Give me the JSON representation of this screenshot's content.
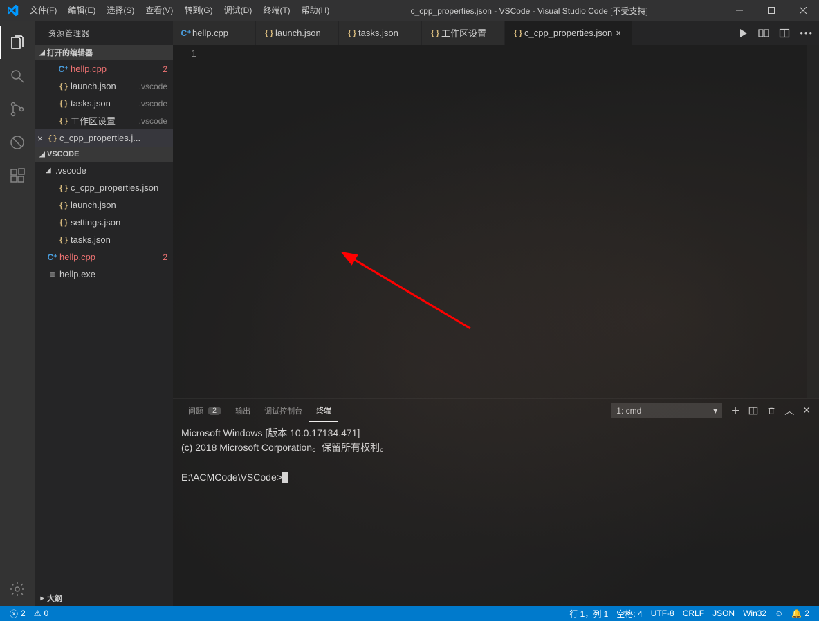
{
  "titlebar": {
    "menus": [
      "文件(F)",
      "编辑(E)",
      "选择(S)",
      "查看(V)",
      "转到(G)",
      "调试(D)",
      "终端(T)",
      "帮助(H)"
    ],
    "title": "c_cpp_properties.json - VSCode - Visual Studio Code [不受支持]"
  },
  "sidebar": {
    "title": "资源管理器",
    "openEditors": {
      "header": "打开的编辑器",
      "items": [
        {
          "icon": "cpp",
          "iconText": "C⁺",
          "name": "hellp.cpp",
          "error": true,
          "badge": "2"
        },
        {
          "icon": "json",
          "iconText": "{ }",
          "name": "launch.json",
          "path": ".vscode"
        },
        {
          "icon": "json",
          "iconText": "{ }",
          "name": "tasks.json",
          "path": ".vscode"
        },
        {
          "icon": "json",
          "iconText": "{ }",
          "name": "工作区设置",
          "path": ".vscode"
        },
        {
          "icon": "json",
          "iconText": "{ }",
          "name": "c_cpp_properties.j...",
          "active": true,
          "close": true
        }
      ]
    },
    "workspace": {
      "header": "VSCODE",
      "folder": ".vscode",
      "folderFiles": [
        {
          "icon": "json",
          "iconText": "{ }",
          "name": "c_cpp_properties.json"
        },
        {
          "icon": "json",
          "iconText": "{ }",
          "name": "launch.json"
        },
        {
          "icon": "json",
          "iconText": "{ }",
          "name": "settings.json"
        },
        {
          "icon": "json",
          "iconText": "{ }",
          "name": "tasks.json"
        }
      ],
      "rootFiles": [
        {
          "icon": "cpp",
          "iconText": "C⁺",
          "name": "hellp.cpp",
          "error": true,
          "badge": "2"
        },
        {
          "icon": "exe",
          "iconText": "≡",
          "name": "hellp.exe"
        }
      ]
    },
    "outline": "大纲"
  },
  "tabs": [
    {
      "icon": "cpp",
      "iconText": "C⁺",
      "label": "hellp.cpp"
    },
    {
      "icon": "json",
      "iconText": "{ }",
      "label": "launch.json"
    },
    {
      "icon": "json",
      "iconText": "{ }",
      "label": "tasks.json"
    },
    {
      "icon": "json",
      "iconText": "{ }",
      "label": "工作区设置"
    },
    {
      "icon": "json",
      "iconText": "{ }",
      "label": "c_cpp_properties.json",
      "active": true,
      "close": true
    }
  ],
  "editor": {
    "lineNumber": "1"
  },
  "panel": {
    "tabs": {
      "problems": "问题",
      "problemsCount": "2",
      "output": "输出",
      "debug": "调试控制台",
      "terminal": "终端"
    },
    "terminalSelect": "1: cmd",
    "terminalLines": [
      "Microsoft Windows [版本 10.0.17134.471]",
      "(c) 2018 Microsoft Corporation。保留所有权利。",
      "",
      "E:\\ACMCode\\VSCode>"
    ]
  },
  "statusbar": {
    "errors": "2",
    "warnings": "0",
    "right": [
      "行 1，列 1",
      "空格: 4",
      "UTF-8",
      "CRLF",
      "JSON",
      "Win32"
    ],
    "bell": "2"
  }
}
